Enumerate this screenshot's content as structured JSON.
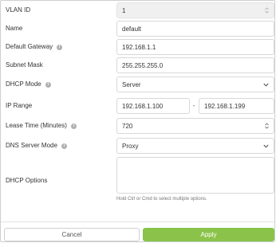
{
  "form": {
    "vlan_id": {
      "label": "VLAN ID",
      "value": "1"
    },
    "name": {
      "label": "Name",
      "value": "default"
    },
    "gateway": {
      "label": "Default Gateway",
      "value": "192.168.1.1"
    },
    "subnet": {
      "label": "Subnet Mask",
      "value": "255.255.255.0"
    },
    "dhcp_mode": {
      "label": "DHCP Mode",
      "value": "Server"
    },
    "ip_range": {
      "label": "IP Range",
      "start": "192.168.1.100",
      "separator": "-",
      "end": "192.168.1.199"
    },
    "lease_time": {
      "label": "Lease Time (Minutes)",
      "value": "720"
    },
    "dns_mode": {
      "label": "DNS Server Mode",
      "value": "Proxy"
    },
    "dhcp_options": {
      "label": "DHCP Options",
      "value": "",
      "hint": "Hold Ctrl or Cmd to select multiple options."
    }
  },
  "footer": {
    "cancel_label": "Cancel",
    "apply_label": "Apply"
  },
  "info_icon_glyph": "i",
  "colors": {
    "apply": "#8bc34a",
    "disabled_field": "#f0f0f0",
    "info_icon": "#b0b0b0"
  }
}
